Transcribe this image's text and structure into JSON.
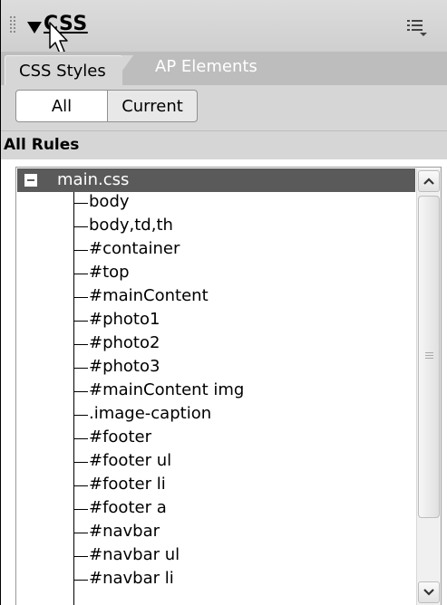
{
  "panel": {
    "title": "CSS",
    "icons": {
      "grip": "gripper-icon",
      "collapse": "collapse-arrow-icon",
      "options": "options-menu-icon",
      "cursor": "mouse-pointer-icon"
    }
  },
  "tabs": [
    {
      "label": "CSS Styles",
      "selected": true
    },
    {
      "label": "AP Elements",
      "selected": false
    }
  ],
  "mode_toggle": {
    "all": "All",
    "current": "Current",
    "selected": "All"
  },
  "rules": {
    "heading": "All Rules",
    "stylesheet": "main.css",
    "items": [
      "body",
      "body,td,th",
      "#container",
      "#top",
      "#mainContent",
      "#photo1",
      "#photo2",
      "#photo3",
      "#mainContent img",
      ".image-caption",
      "#footer",
      "#footer ul",
      "#footer li",
      "#footer a",
      "#navbar",
      "#navbar ul",
      "#navbar li"
    ]
  },
  "colors": {
    "header_bg": "#d3d3d3",
    "tabbar_bg": "#bdbdbd",
    "selected_row_bg": "#5a5a5a"
  }
}
